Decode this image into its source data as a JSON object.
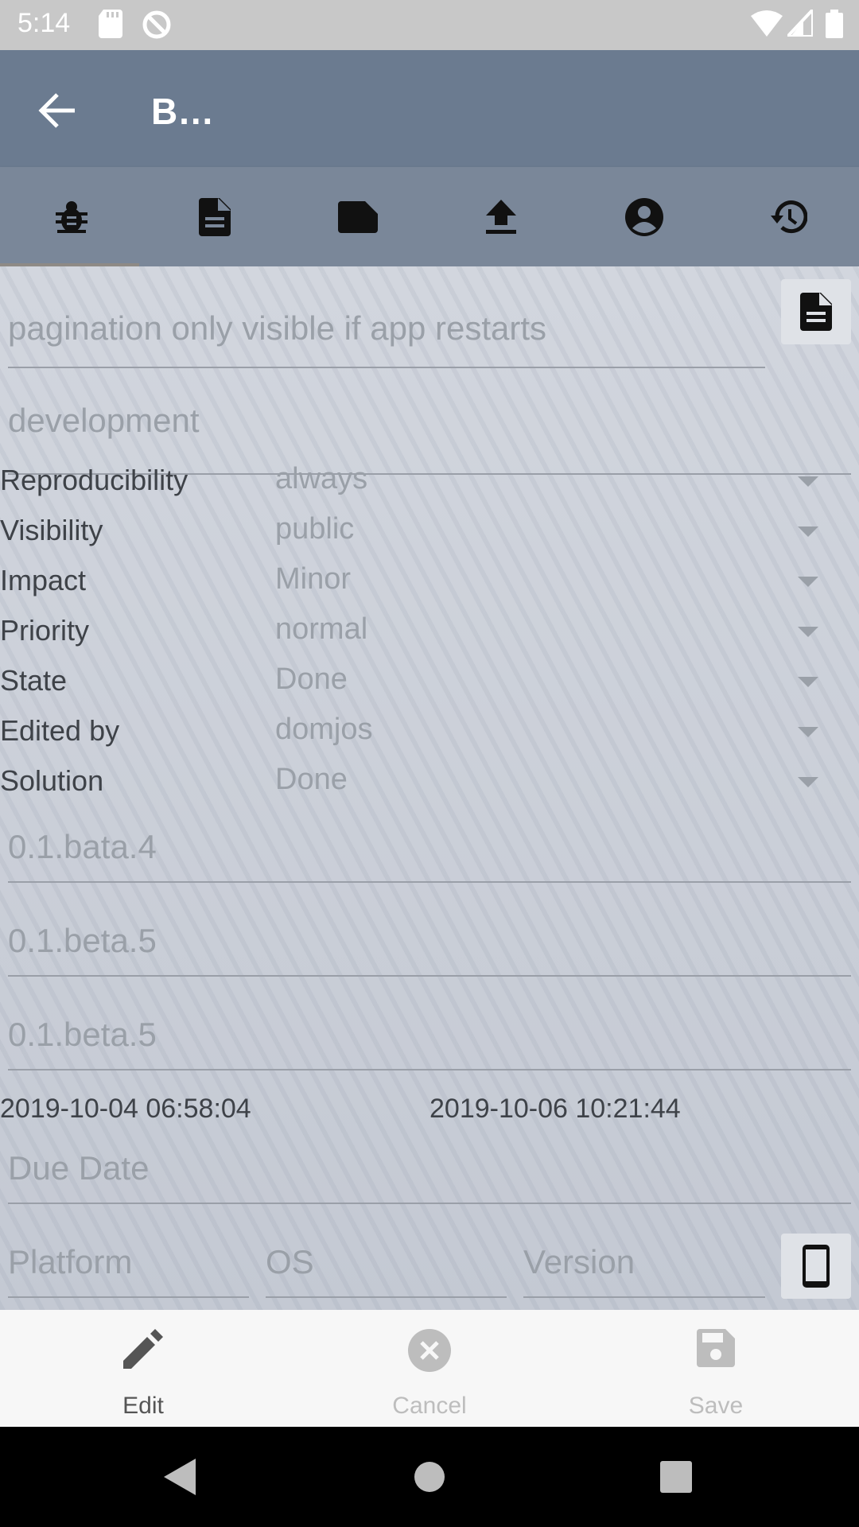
{
  "status_bar": {
    "time": "5:14"
  },
  "app_bar": {
    "title": "B…"
  },
  "tabs": [
    {
      "icon": "bug-icon"
    },
    {
      "icon": "document-icon"
    },
    {
      "icon": "label-icon"
    },
    {
      "icon": "upload-icon"
    },
    {
      "icon": "account-circle-icon"
    },
    {
      "icon": "history-icon"
    }
  ],
  "form": {
    "summary": "pagination only visible if app restarts",
    "category": "development",
    "properties": [
      {
        "label": "Reproducibility",
        "value": "always"
      },
      {
        "label": "Visibility",
        "value": "public"
      },
      {
        "label": "Impact",
        "value": "Minor"
      },
      {
        "label": "Priority",
        "value": "normal"
      },
      {
        "label": "State",
        "value": "Done"
      },
      {
        "label": "Edited by",
        "value": "domjos"
      },
      {
        "label": "Solution",
        "value": "Done"
      }
    ],
    "version_found": "0.1.bata.4",
    "version_fixed": "0.1.beta.5",
    "version_target": "0.1.beta.5",
    "created_date": "2019-10-04 06:58:04",
    "updated_date": "2019-10-06 10:21:44",
    "due_date_placeholder": "Due Date",
    "platform_placeholder": "Platform",
    "os_placeholder": "OS",
    "version_placeholder": "Version"
  },
  "actions": {
    "edit": "Edit",
    "cancel": "Cancel",
    "save": "Save"
  },
  "colors": {
    "app_bar": "#6b7b90",
    "tab_bar": "#7a8799",
    "status_bar": "#c8c8c8"
  }
}
